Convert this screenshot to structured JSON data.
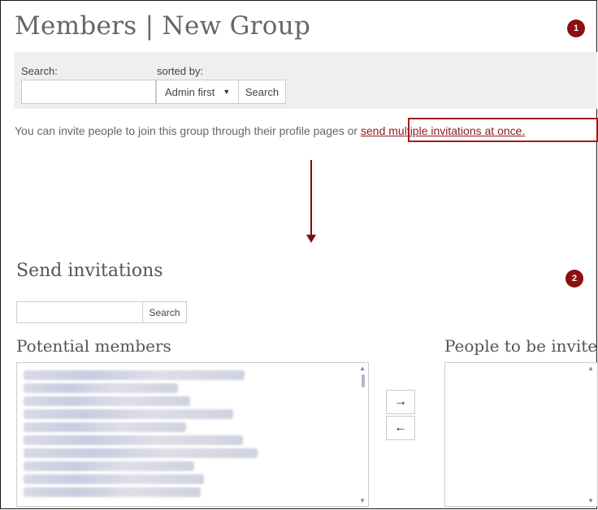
{
  "page_title": "Members | New Group",
  "badges": {
    "one": "1",
    "two": "2"
  },
  "search_panel": {
    "search_label": "Search:",
    "sorted_label": "sorted by:",
    "sort_value": "Admin first",
    "search_button": "Search"
  },
  "info_text": {
    "prefix": "You can invite people to join this group through their profile pages or ",
    "link": "send multiple invitations at once."
  },
  "send_invitations": {
    "heading": "Send invitations",
    "search_button": "Search",
    "potential_heading": "Potential members",
    "invited_heading": "People to be invited",
    "move_right": "→",
    "move_left": "←"
  },
  "colors": {
    "accent": "#8b1010",
    "panel_bg": "#efefef",
    "link": "#8b1a1a"
  }
}
